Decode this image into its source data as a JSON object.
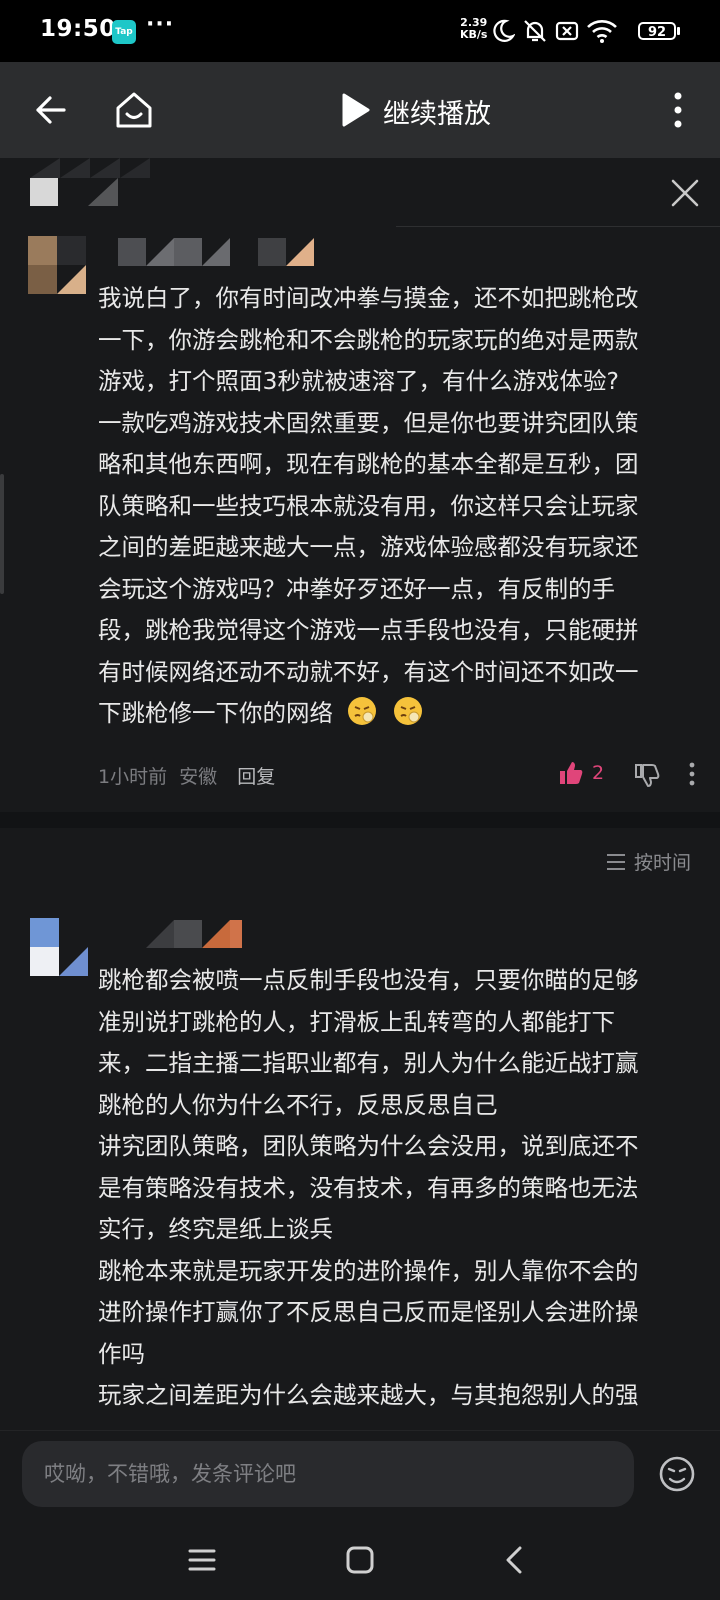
{
  "status_bar": {
    "time": "19:50",
    "app_icon_label": "Tap",
    "more_dots": "···",
    "net_speed_value": "2.39",
    "net_speed_unit": "KB/s",
    "battery": "92",
    "icons": [
      "moon-icon",
      "bell-muted-icon",
      "sim-off-icon",
      "wifi-icon"
    ]
  },
  "header": {
    "play_label": "继续播放",
    "icons": [
      "back-arrow-icon",
      "home-icon",
      "play-icon",
      "more-vertical-icon"
    ]
  },
  "comments": [
    {
      "lines": [
        "我说白了，你有时间改冲拳与摸金，还不如把跳枪改",
        "一下，你游会跳枪和不会跳枪的玩家玩的绝对是两款",
        "游戏，打个照面3秒就被速溶了，有什么游戏体验?",
        "一款吃鸡游戏技术固然重要，但是你也要讲究团队策",
        "略和其他东西啊，现在有跳枪的基本全都是互秒，团",
        "队策略和一些技巧根本就没有用，你这样只会让玩家",
        "之间的差距越来越大一点，游戏体验感都没有玩家还",
        "会玩这个游戏吗？冲拳好歹还好一点，有反制的手",
        "段，跳枪我觉得这个游戏一点手段也没有，只能硬拼",
        "有时候网络还动不动就不好，有这个时间还不如改一",
        "下跳枪修一下你的网络"
      ],
      "time": "1小时前",
      "location": "安徽",
      "reply_label": "回复",
      "like_count": "2"
    },
    {
      "lines": [
        "跳枪都会被喷一点反制手段也没有，只要你瞄的足够",
        "准别说打跳枪的人，打滑板上乱转弯的人都能打下",
        "来，二指主播二指职业都有，别人为什么能近战打赢",
        "跳枪的人你为什么不行，反思反思自己",
        "讲究团队策略，团队策略为什么会没用，说到底还不",
        "是有策略没有技术，没有技术，有再多的策略也无法",
        "实行，终究是纸上谈兵",
        "跳枪本来就是玩家开发的进阶操作，别人靠你不会的",
        "进阶操作打赢你了不反思自己反而是怪别人会进阶操",
        "作吗",
        "玩家之间差距为什么会越来越大，与其抱怨别人的强"
      ]
    }
  ],
  "sort": {
    "label": "按时间"
  },
  "input": {
    "placeholder": "哎呦，不错哦，发条评论吧"
  },
  "colors": {
    "background": "#18191b",
    "header": "#2c2d2f",
    "like_accent": "#e0457a",
    "meta_text": "#7b7c80"
  }
}
